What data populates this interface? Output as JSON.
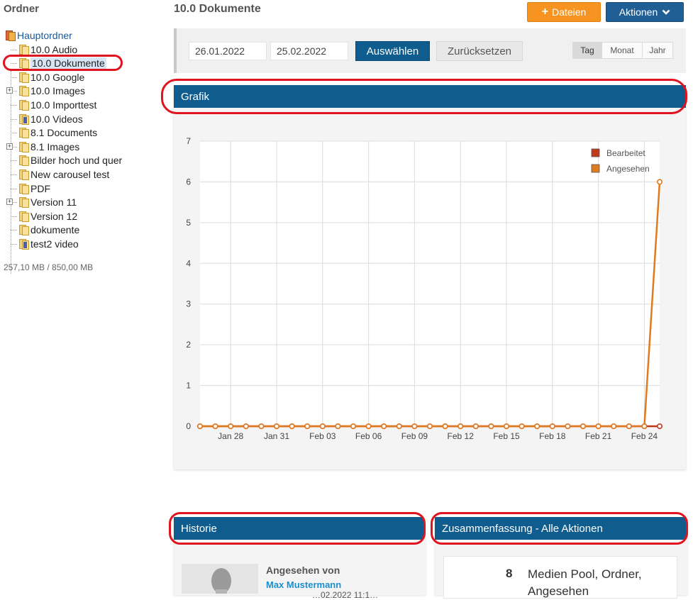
{
  "sidebar": {
    "title": "Ordner",
    "root_label": "Hauptordner",
    "items": [
      {
        "label": "10.0 Audio",
        "icon": "folder-icon",
        "expandable": false
      },
      {
        "label": "10.0 Dokumente",
        "icon": "folder-icon",
        "expandable": false,
        "selected": true
      },
      {
        "label": "10.0 Google",
        "icon": "folder-icon",
        "expandable": false
      },
      {
        "label": "10.0 Images",
        "icon": "folder-icon",
        "expandable": true
      },
      {
        "label": "10.0 Importtest",
        "icon": "folder-icon",
        "expandable": false
      },
      {
        "label": "10.0 Videos",
        "icon": "video-folder-icon",
        "expandable": false
      },
      {
        "label": "8.1 Documents",
        "icon": "folder-icon",
        "expandable": false
      },
      {
        "label": "8.1 Images",
        "icon": "folder-icon",
        "expandable": true
      },
      {
        "label": "Bilder hoch und quer",
        "icon": "folder-icon",
        "expandable": false
      },
      {
        "label": "New carousel test",
        "icon": "folder-icon",
        "expandable": false
      },
      {
        "label": "PDF",
        "icon": "folder-icon",
        "expandable": false
      },
      {
        "label": "Version 11",
        "icon": "folder-icon",
        "expandable": true
      },
      {
        "label": "Version 12",
        "icon": "folder-icon",
        "expandable": false
      },
      {
        "label": "dokumente",
        "icon": "folder-icon",
        "expandable": false
      },
      {
        "label": "test2 video",
        "icon": "video-folder-icon",
        "expandable": false
      }
    ],
    "quota": "257,10 MB / 850,00 MB"
  },
  "header": {
    "title": "10.0 Dokumente",
    "add_files_label": "Dateien",
    "actions_label": "Aktionen"
  },
  "filter": {
    "date_from": "26.01.2022",
    "date_to": "25.02.2022",
    "select_label": "Auswählen",
    "reset_label": "Zurücksetzen",
    "granularity": [
      "Tag",
      "Monat",
      "Jahr"
    ],
    "active_granularity": "Tag"
  },
  "grafik": {
    "title": "Grafik"
  },
  "chart_data": {
    "type": "line",
    "x_tick_labels": [
      "Jan 28",
      "Jan 31",
      "Feb 03",
      "Feb 06",
      "Feb 09",
      "Feb 12",
      "Feb 15",
      "Feb 18",
      "Feb 21",
      "Feb 24"
    ],
    "x": [
      "Jan 26",
      "Jan 27",
      "Jan 28",
      "Jan 29",
      "Jan 30",
      "Jan 31",
      "Feb 01",
      "Feb 02",
      "Feb 03",
      "Feb 04",
      "Feb 05",
      "Feb 06",
      "Feb 07",
      "Feb 08",
      "Feb 09",
      "Feb 10",
      "Feb 11",
      "Feb 12",
      "Feb 13",
      "Feb 14",
      "Feb 15",
      "Feb 16",
      "Feb 17",
      "Feb 18",
      "Feb 19",
      "Feb 20",
      "Feb 21",
      "Feb 22",
      "Feb 23",
      "Feb 24",
      "Feb 25"
    ],
    "series": [
      {
        "name": "Bearbeitet",
        "color": "#c0391b",
        "values": [
          0,
          0,
          0,
          0,
          0,
          0,
          0,
          0,
          0,
          0,
          0,
          0,
          0,
          0,
          0,
          0,
          0,
          0,
          0,
          0,
          0,
          0,
          0,
          0,
          0,
          0,
          0,
          0,
          0,
          0,
          0
        ]
      },
      {
        "name": "Angesehen",
        "color": "#e07a1f",
        "values": [
          0,
          0,
          0,
          0,
          0,
          0,
          0,
          0,
          0,
          0,
          0,
          0,
          0,
          0,
          0,
          0,
          0,
          0,
          0,
          0,
          0,
          0,
          0,
          0,
          0,
          0,
          0,
          0,
          0,
          0,
          6
        ]
      }
    ],
    "ylim": [
      0,
      7
    ],
    "y_ticks": [
      0,
      1,
      2,
      3,
      4,
      5,
      6,
      7
    ],
    "grid": true,
    "legend": "top-right"
  },
  "historie": {
    "title": "Historie",
    "entry_label": "Angesehen von",
    "entry_user": "Max Mustermann",
    "entry_time": "…02.2022 11:1…"
  },
  "summary": {
    "title": "Zusammenfassung - Alle Aktionen",
    "count": "8",
    "text": "Medien Pool, Ordner, Angesehen"
  },
  "colors": {
    "header_blue": "#0f5c8f",
    "orange_button": "#f79421",
    "highlight_ring": "#e0141e"
  }
}
